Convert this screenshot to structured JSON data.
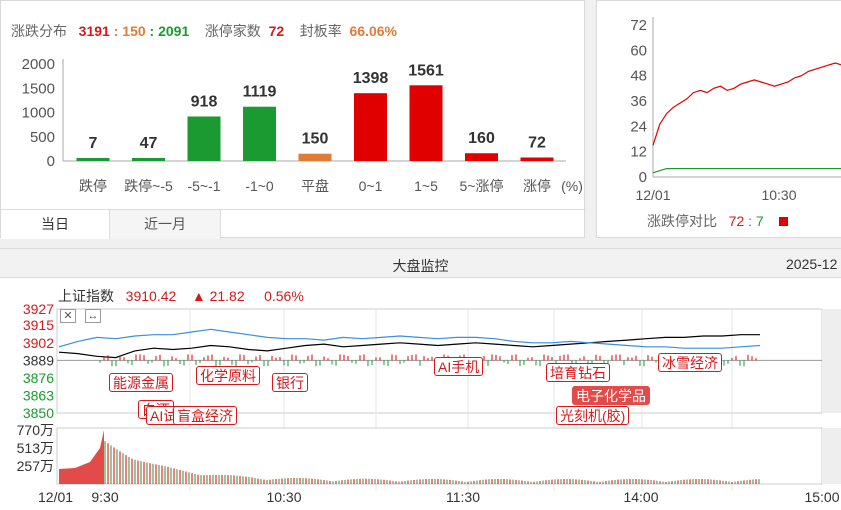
{
  "distribution": {
    "label": "涨跌分布",
    "up_count": "3191",
    "flat_count": "150",
    "down_count": "2091",
    "sep": ":",
    "limit_label": "涨停家数",
    "limit_value": "72",
    "seal_label": "封板率",
    "seal_value": "66.06%"
  },
  "tabs": [
    {
      "label": "当日"
    },
    {
      "label": "近一月"
    }
  ],
  "chart_data": [
    {
      "type": "bar",
      "categories": [
        "跌停",
        "跌停~-5",
        "-5~-1",
        "-1~0",
        "平盘",
        "0~1",
        "1~5",
        "5~涨停",
        "涨停"
      ],
      "values": [
        7,
        47,
        918,
        1119,
        150,
        1398,
        1561,
        160,
        72
      ],
      "value_labels": [
        "7",
        "47",
        "918",
        "1119",
        "150",
        "1398",
        "1561",
        "160",
        "72"
      ],
      "colors": [
        "#1a9a30",
        "#1a9a30",
        "#1a9a30",
        "#1a9a30",
        "#e07b39",
        "#e00000",
        "#e00000",
        "#e00000",
        "#e00000"
      ],
      "ylim": [
        0,
        2000
      ],
      "yticks": [
        "2000",
        "1500",
        "1000",
        "500",
        "0"
      ],
      "unit": "(%)"
    },
    {
      "type": "line",
      "x_ticks": [
        "12/01",
        "10:30"
      ],
      "y_ticks": [
        "72",
        "60",
        "48",
        "36",
        "24",
        "12",
        "0"
      ],
      "ylim": [
        0,
        72
      ],
      "series": [
        {
          "color": "#e00000",
          "values": [
            15,
            25,
            30,
            33,
            35,
            37,
            40,
            41,
            40,
            42,
            43,
            41,
            42,
            44,
            45,
            46,
            45,
            44,
            43,
            44,
            45,
            47,
            48,
            50,
            51,
            52,
            53,
            54,
            53
          ]
        },
        {
          "color": "#1a9a30",
          "values": [
            2,
            3,
            4,
            4,
            4,
            4,
            4,
            4,
            4,
            4,
            4,
            4,
            4,
            4,
            4,
            4,
            4,
            4,
            4,
            4,
            4,
            4,
            4,
            4,
            4,
            4,
            4,
            4,
            4
          ]
        }
      ]
    },
    {
      "type": "line",
      "y_ticks": [
        "3927",
        "3915",
        "3902",
        "3889",
        "3876",
        "3863",
        "3850"
      ],
      "y_tick_colors": [
        "#d7191b",
        "#d7191b",
        "#d7191b",
        "#333333",
        "#1a9a30",
        "#1a9a30",
        "#1a9a30"
      ],
      "ylim": [
        3850,
        3927
      ],
      "series": [
        {
          "color": "#000000",
          "values": [
            3895,
            3894,
            3892,
            3891,
            3896,
            3898,
            3897,
            3898,
            3900,
            3899,
            3897,
            3896,
            3898,
            3900,
            3901,
            3899,
            3900,
            3901,
            3902,
            3901,
            3900,
            3901,
            3902,
            3901,
            3900,
            3899,
            3900,
            3901,
            3902,
            3903,
            3904,
            3905,
            3906,
            3906,
            3907,
            3907,
            3908,
            3908
          ]
        },
        {
          "color": "#3a8ee6",
          "values": [
            3899,
            3903,
            3906,
            3905,
            3907,
            3908,
            3908,
            3910,
            3912,
            3910,
            3908,
            3906,
            3905,
            3905,
            3904,
            3906,
            3905,
            3906,
            3907,
            3906,
            3905,
            3906,
            3906,
            3905,
            3903,
            3902,
            3902,
            3903,
            3902,
            3901,
            3900,
            3899,
            3899,
            3898,
            3898,
            3898,
            3899,
            3900
          ]
        }
      ]
    },
    {
      "type": "bar",
      "y_ticks": [
        "770万",
        "513万",
        "257万"
      ],
      "x_ticks": [
        "12/01",
        "9:30",
        "10:30",
        "11:30",
        "14:00",
        "15:00"
      ]
    }
  ],
  "limit_panel": {
    "label": "涨跌停对比",
    "up": "72",
    "sep": ":",
    "down": "7"
  },
  "monitor": {
    "title": "大盘监控",
    "date": "2025-12",
    "index_name": "上证指数",
    "index_value": "3910.42",
    "arrow": "▲",
    "change": "21.82",
    "pct": "0.56%",
    "tags": [
      "能源金属",
      "白酒",
      "AI试",
      "盲盒经济",
      "化学原料",
      "银行",
      "AI手机",
      "培育钻石",
      "电子化学品",
      "光刻机(胶)",
      "冰雪经济"
    ]
  }
}
